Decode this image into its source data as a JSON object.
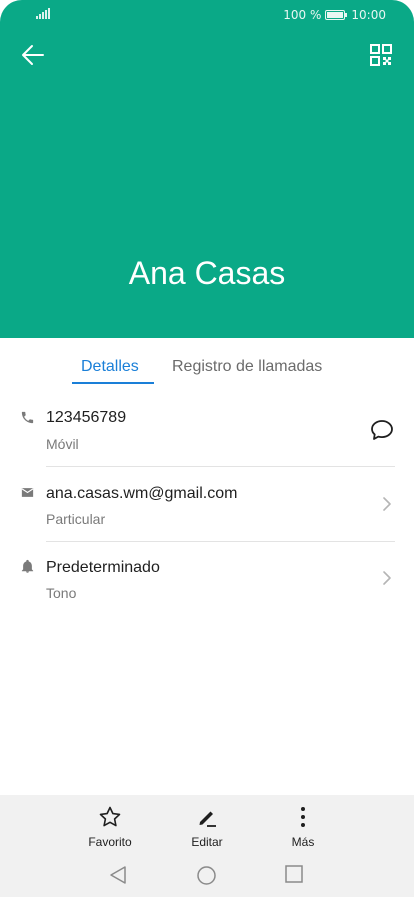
{
  "status_bar": {
    "battery_text": "100 %",
    "time": "10:00"
  },
  "header": {
    "contact_name": "Ana Casas"
  },
  "tabs": [
    {
      "label": "Detalles",
      "selected": true
    },
    {
      "label": "Registro de llamadas",
      "selected": false
    }
  ],
  "details": [
    {
      "icon": "phone-icon",
      "title": "123456789",
      "subtitle": "Móvil"
    },
    {
      "icon": "mail-icon",
      "title": "ana.casas.wm@gmail.com",
      "subtitle": "Particular"
    },
    {
      "icon": "bell-icon",
      "title": "Predeterminado",
      "subtitle": "Tono"
    }
  ],
  "bottom_actions": [
    {
      "icon": "star-icon",
      "label": "Favorito"
    },
    {
      "icon": "pencil-icon",
      "label": "Editar"
    },
    {
      "icon": "more-vertical-icon",
      "label": "Más"
    }
  ],
  "colors": {
    "accent": "#0aa987",
    "tab_active": "#1a7fd8"
  }
}
